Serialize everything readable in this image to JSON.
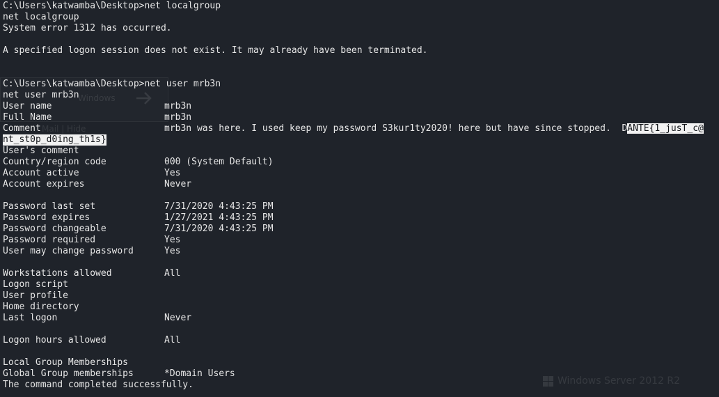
{
  "terminal": {
    "lines": [
      "C:\\Users\\katwamba\\Desktop>net localgroup",
      "net localgroup",
      "System error 1312 has occurred.",
      "",
      "A specified logon session does not exist. It may already have been terminated.",
      "",
      "",
      "C:\\Users\\katwamba\\Desktop>net user mrb3n",
      "net user mrb3n"
    ],
    "fields": {
      "user_name": {
        "key": "User name",
        "value": "mrb3n"
      },
      "full_name": {
        "key": "Full Name",
        "value": "mrb3n"
      },
      "comment": {
        "key": "Comment",
        "value": "mrb3n was here. I used keep my password S3kur1ty2020! here but have since stopped.  D",
        "selected_part1": "ANTE{1_jusT_c@",
        "selected_part2": "nt_st0p_d0ing_th1s}"
      },
      "users_comment": {
        "key": "User's comment",
        "value": ""
      },
      "country_code": {
        "key": "Country/region code",
        "value": "000 (System Default)"
      },
      "account_active": {
        "key": "Account active",
        "value": "Yes"
      },
      "account_expires": {
        "key": "Account expires",
        "value": "Never"
      },
      "password_last_set": {
        "key": "Password last set",
        "value": "7/31/2020 4:43:25 PM"
      },
      "password_expires": {
        "key": "Password expires",
        "value": "1/27/2021 4:43:25 PM"
      },
      "password_changeable": {
        "key": "Password changeable",
        "value": "7/31/2020 4:43:25 PM"
      },
      "password_required": {
        "key": "Password required",
        "value": "Yes"
      },
      "user_may_change": {
        "key": "User may change password",
        "value": "Yes"
      },
      "workstations_allowed": {
        "key": "Workstations allowed",
        "value": "All"
      },
      "logon_script": {
        "key": "Logon script",
        "value": ""
      },
      "user_profile": {
        "key": "User profile",
        "value": ""
      },
      "home_directory": {
        "key": "Home directory",
        "value": ""
      },
      "last_logon": {
        "key": "Last logon",
        "value": "Never"
      },
      "logon_hours": {
        "key": "Logon hours allowed",
        "value": "All"
      },
      "local_groups": {
        "key": "Local Group Memberships",
        "value": ""
      },
      "global_groups": {
        "key": "Global Group memberships",
        "value": "*Domain Users"
      }
    },
    "footer": "The command completed successfully."
  },
  "background": {
    "ghost_text_1": "Windows",
    "ghost_text_2": "Mail | Hide",
    "watermark": "Windows Server 2012 R2"
  },
  "colors": {
    "background": "#1f232a",
    "text": "#e6e6e6",
    "selection_bg": "#f2f2f2"
  }
}
